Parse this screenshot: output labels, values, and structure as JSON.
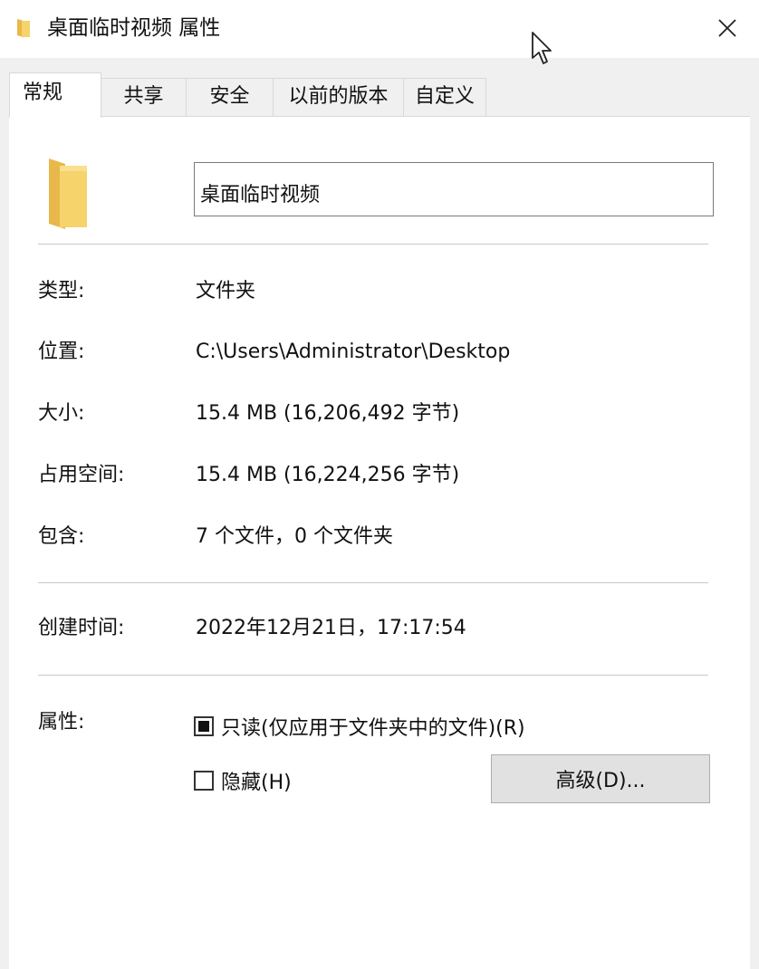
{
  "window": {
    "title": "桌面临时视频 属性",
    "close_label": "×"
  },
  "tabs": [
    {
      "label": "常规",
      "active": true
    },
    {
      "label": "共享",
      "active": false
    },
    {
      "label": "安全",
      "active": false
    },
    {
      "label": "以前的版本",
      "active": false
    },
    {
      "label": "自定义",
      "active": false
    }
  ],
  "general": {
    "folder_name": "桌面临时视频",
    "type_label": "类型:",
    "type_value": "文件夹",
    "location_label": "位置:",
    "location_value": "C:\\Users\\Administrator\\Desktop",
    "size_label": "大小:",
    "size_value": "15.4 MB (16,206,492 字节)",
    "disk_size_label": "占用空间:",
    "disk_size_value": "15.4 MB (16,224,256 字节)",
    "contains_label": "包含:",
    "contains_value": "7 个文件，0 个文件夹",
    "created_label": "创建时间:",
    "created_value": "2022年12月21日，17:17:54",
    "attributes_label": "属性:",
    "readonly_label": "只读(仅应用于文件夹中的文件)(R)",
    "readonly_state": "indeterminate",
    "hidden_label": "隐藏(H)",
    "hidden_checked": false,
    "advanced_button_label": "高级(D)..."
  },
  "colors": {
    "folder_yellow": "#f6d36b",
    "folder_shade": "#e8b84a",
    "button_bg": "#e1e1e1"
  },
  "icons": {
    "title": "folder-icon",
    "close": "close-icon",
    "large": "folder-icon",
    "pointer": "mouse-cursor-icon"
  }
}
